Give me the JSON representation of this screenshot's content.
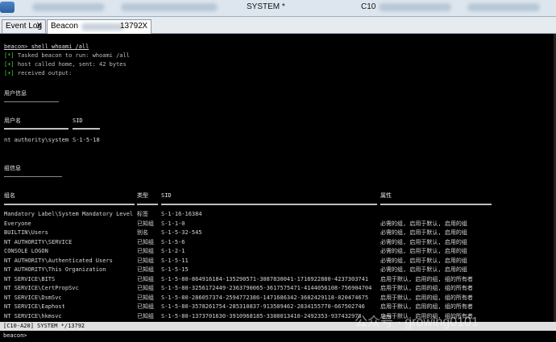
{
  "titlebar": {
    "system_label": "SYSTEM *",
    "client_label": "C10"
  },
  "tabs": [
    {
      "label": "Event Log",
      "close": "X"
    },
    {
      "label": "Beacon",
      "suffix": "13792",
      "close": "X"
    }
  ],
  "terminal": {
    "command": "beacon> shell whoami /all",
    "log": [
      {
        "mark": "[*]",
        "text": " Tasked beacon to run: whoami /all"
      },
      {
        "mark": "[+]",
        "text": " host called home, sent: 42 bytes"
      },
      {
        "mark": "[+]",
        "text": " received output:"
      }
    ],
    "user_info_title": "用户信息",
    "user_table": {
      "headers": [
        "用户名",
        "SID"
      ],
      "row": [
        "nt authority\\system",
        "S-1-5-18"
      ]
    },
    "group_info_title": "组信息",
    "group_table": {
      "headers": [
        "组名",
        "类型",
        "SID",
        "属性"
      ],
      "rows": [
        [
          "Mandatory Label\\System Mandatory Level",
          "标签",
          "S-1-16-16384",
          ""
        ],
        [
          "Everyone",
          "已知组",
          "S-1-1-0",
          "必需的组, 启用于默认, 启用的组"
        ],
        [
          "BUILTIN\\Users",
          "别名",
          "S-1-5-32-545",
          "必需的组, 启用于默认, 启用的组"
        ],
        [
          "NT AUTHORITY\\SERVICE",
          "已知组",
          "S-1-5-6",
          "必需的组, 启用于默认, 启用的组"
        ],
        [
          "CONSOLE LOGON",
          "已知组",
          "S-1-2-1",
          "必需的组, 启用于默认, 启用的组"
        ],
        [
          "NT AUTHORITY\\Authenticated Users",
          "已知组",
          "S-1-5-11",
          "必需的组, 启用于默认, 启用的组"
        ],
        [
          "NT AUTHORITY\\This Organization",
          "已知组",
          "S-1-5-15",
          "必需的组, 启用于默认, 启用的组"
        ],
        [
          "NT SERVICE\\BITS",
          "已知组",
          "S-1-5-80-864916184-135290571-3087830041-1716922880-4237303741",
          "启用于默认, 启用的组, 组的所有者"
        ],
        [
          "NT SERVICE\\CertPropSvc",
          "已知组",
          "S-1-5-80-3256172449-2363790065-3617575471-4144056108-756904704",
          "启用于默认, 启用的组, 组的所有者"
        ],
        [
          "NT SERVICE\\DsmSvc",
          "已知组",
          "S-1-5-80-286057374-2594772386-1471686342-3682429118-820474675",
          "启用于默认, 启用的组, 组的所有者"
        ],
        [
          "NT SERVICE\\Eaphost",
          "已知组",
          "S-1-5-80-3578261754-285310837-913589462-2834155770-667502746",
          "启用于默认, 启用的组, 组的所有者"
        ],
        [
          "NT SERVICE\\hkmsvc",
          "已知组",
          "S-1-5-80-1373701630-3910968185-3388013410-2492353-937432978",
          "启用于默认, 启用的组, 组的所有者"
        ]
      ]
    }
  },
  "statusbar": {
    "text": "[C10-A20] SYSTEM */13792"
  },
  "input": {
    "prompt": "beacon>"
  },
  "watermark": "公众号 · growing0101",
  "colors": {
    "terminal_bg": "#000000",
    "log_mark": "#49d84b",
    "status_bg": "#e0e0e0"
  }
}
